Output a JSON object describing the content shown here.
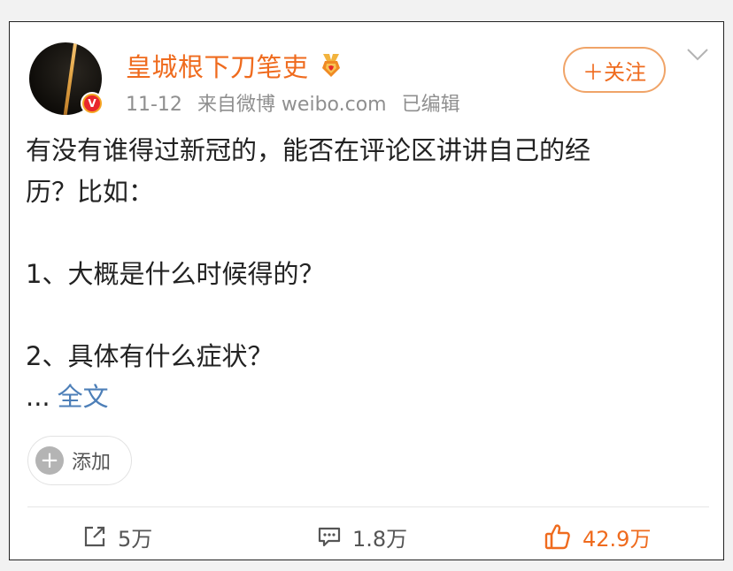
{
  "post": {
    "author": {
      "name": "皇城根下刀笔吏",
      "verified_badge": "V"
    },
    "meta": {
      "date": "11-12",
      "source": "来自微博 weibo.com",
      "edited": "已编辑"
    },
    "follow_label": "＋关注",
    "text_lines": [
      "有没有谁得过新冠的，能否在评论区讲讲自己的经",
      "历？比如：",
      "",
      "1、大概是什么时候得的？",
      "",
      "2、具体有什么症状？"
    ],
    "ellipsis": "...",
    "more_label": "全文",
    "add_label": "添加"
  },
  "actions": {
    "repost_count": "5万",
    "comment_count": "1.8万",
    "like_count": "42.9万"
  },
  "colors": {
    "accent": "#ef6b1e",
    "link": "#4d7fb8",
    "meta_gray": "#8f8f8f"
  },
  "icons": {
    "avatar": "avatar-image",
    "verified": "verified-v-icon",
    "medal": "medal-icon",
    "chevron": "chevron-down-icon",
    "repost": "repost-icon",
    "comment": "comment-icon",
    "like": "thumbs-up-icon"
  }
}
